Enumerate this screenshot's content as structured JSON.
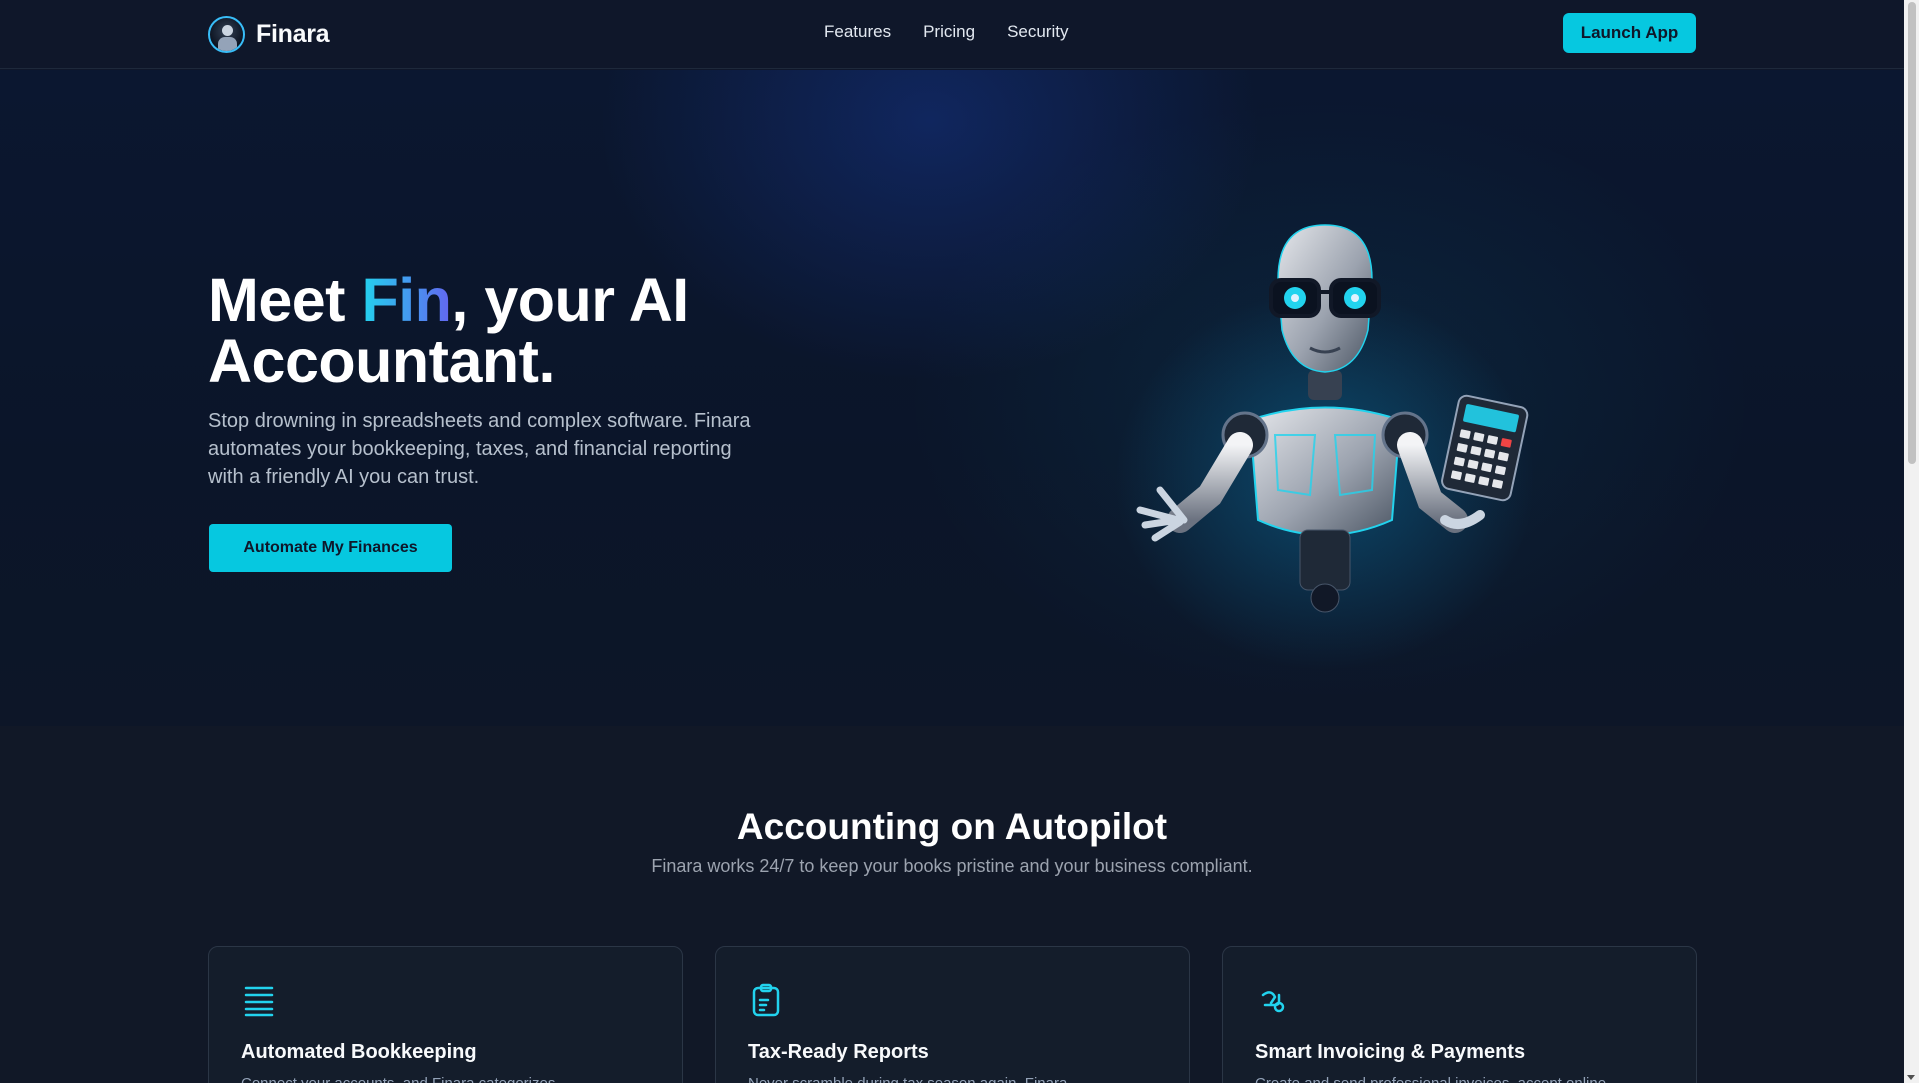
{
  "nav": {
    "brand": "Finara",
    "links": [
      "Features",
      "Pricing",
      "Security"
    ],
    "launch_label": "Launch App"
  },
  "hero": {
    "title_pre": "Meet ",
    "title_accent": "Fin",
    "title_post": ", your AI Accountant.",
    "subtitle": "Stop drowning in spreadsheets and complex software. Finara automates your bookkeeping, taxes, and financial reporting with a friendly AI you can trust.",
    "cta_label": "Automate My Finances"
  },
  "features": {
    "title": "Accounting on Autopilot",
    "subtitle": "Finara works 24/7 to keep your books pristine and your business compliant.",
    "cards": [
      {
        "icon": "ledger-lines-icon",
        "title": "Automated Bookkeeping",
        "desc": "Connect your accounts, and Finara categorizes"
      },
      {
        "icon": "clipboard-report-icon",
        "title": "Tax-Ready Reports",
        "desc": "Never scramble during tax season again. Finara"
      },
      {
        "icon": "hand-coin-icon",
        "title": "Smart Invoicing & Payments",
        "desc": "Create and send professional invoices, accept online"
      }
    ]
  },
  "colors": {
    "accent": "#06c8e0",
    "background": "#0f172a",
    "gradient_start": "#22d3ee",
    "gradient_end": "#6366f1"
  }
}
